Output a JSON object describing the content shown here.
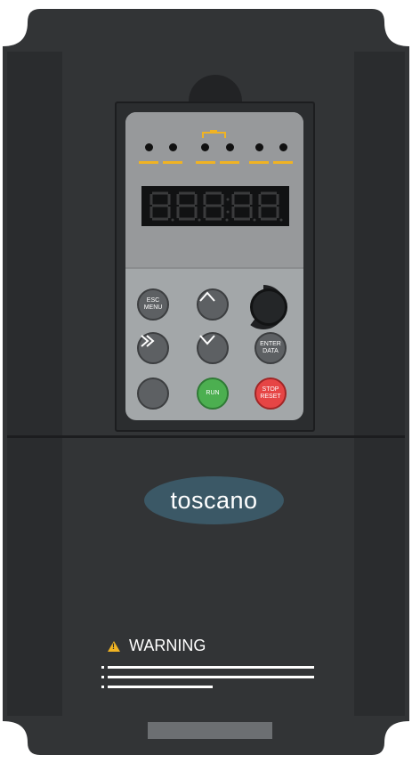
{
  "device": {
    "brand_logo_text": "toscano",
    "display_digits": "88888"
  },
  "keypad": {
    "esc_label": "ESC\nMENU",
    "enter_label": "ENTER\nDATA",
    "run_label": "RUN",
    "stop_label": "STOP\nRESET",
    "up_icon": "chevron-up-icon",
    "down_icon": "chevron-down-icon",
    "shift_icon": "double-chevron-right-icon",
    "knob_icon": "potentiometer-knob"
  },
  "warning": {
    "label": "WARNING",
    "icon": "warning-triangle-icon"
  },
  "colors": {
    "body": "#323436",
    "accent_led": "#f0b323",
    "run": "#4caf50",
    "stop": "#e64545",
    "logo_badge": "#3b5866"
  }
}
